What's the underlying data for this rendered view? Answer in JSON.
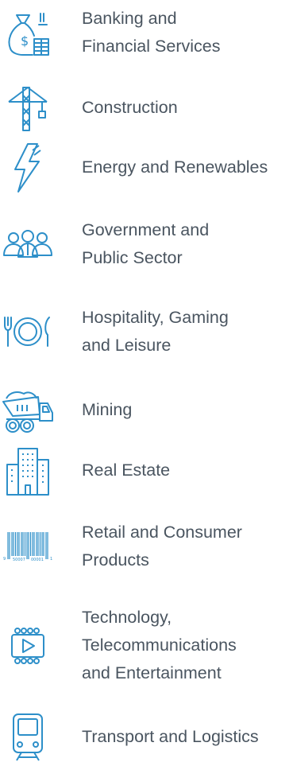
{
  "industries": [
    {
      "name": "banking",
      "icon": "money-bag-icon",
      "lines": [
        "Banking and",
        "Financial Services"
      ]
    },
    {
      "name": "construction",
      "icon": "crane-icon",
      "lines": [
        "Construction"
      ]
    },
    {
      "name": "energy",
      "icon": "lightning-bolt-icon",
      "lines": [
        "Energy and Renewables"
      ]
    },
    {
      "name": "government",
      "icon": "people-group-icon",
      "lines": [
        "Government and",
        "Public Sector"
      ]
    },
    {
      "name": "hospitality",
      "icon": "place-setting-icon",
      "lines": [
        "Hospitality, Gaming",
        "and Leisure"
      ]
    },
    {
      "name": "mining",
      "icon": "dump-truck-icon",
      "lines": [
        "Mining"
      ]
    },
    {
      "name": "real-estate",
      "icon": "buildings-icon",
      "lines": [
        "Real Estate"
      ]
    },
    {
      "name": "retail",
      "icon": "barcode-icon",
      "lines": [
        "Retail and Consumer",
        "Products"
      ]
    },
    {
      "name": "technology",
      "icon": "video-play-icon",
      "lines": [
        "Technology,",
        "Telecommunications",
        "and Entertainment"
      ]
    },
    {
      "name": "transport",
      "icon": "train-icon",
      "lines": [
        "Transport and Logistics"
      ]
    }
  ],
  "barcode_text": {
    "left": "9",
    "mid1": "50007",
    "mid2": "00001",
    "right": "1"
  },
  "colors": {
    "text": "#4a5560",
    "icon": "#2d8fc9"
  }
}
